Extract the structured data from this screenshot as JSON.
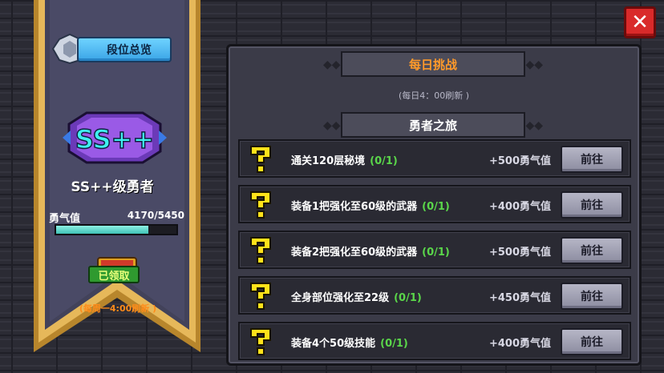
{
  "banner": {
    "rank_overview_label": "段位总览",
    "logo_text": "SS++",
    "rank_title": "SS++级勇者",
    "courage_label": "勇气值",
    "courage_value": "4170/5450",
    "courage_progress": 0.765,
    "claimed_label": "已领取",
    "weekly_refresh": "(每周一4:00刷新 )"
  },
  "daily": {
    "title": "每日挑战",
    "refresh_note": "(每日4：00刷新 )"
  },
  "journey": {
    "title": "勇者之旅",
    "tasks": [
      {
        "name": "通关120层秘境",
        "progress": "(0/1)",
        "reward": "+500勇气值",
        "button": "前往"
      },
      {
        "name": "装备1把强化至60级的武器",
        "progress": "(0/1)",
        "reward": "+400勇气值",
        "button": "前往"
      },
      {
        "name": "装备2把强化至60级的武器",
        "progress": "(0/1)",
        "reward": "+500勇气值",
        "button": "前往"
      },
      {
        "name": "全身部位强化至22级",
        "progress": "(0/1)",
        "reward": "+450勇气值",
        "button": "前往"
      },
      {
        "name": "装备4个50级技能",
        "progress": "(0/1)",
        "reward": "+400勇气值",
        "button": "前往"
      }
    ]
  },
  "close_symbol": "✕",
  "colors": {
    "accent_orange": "#ff9a2a",
    "progress_green": "#5ad64a",
    "bar_teal": "#3fc2b5",
    "close_red": "#d92a2a",
    "question_yellow": "#ffe21a"
  }
}
